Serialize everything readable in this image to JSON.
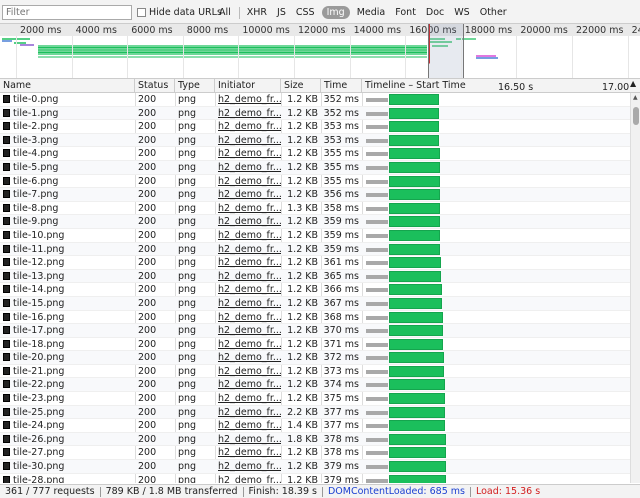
{
  "filterbar": {
    "filter_placeholder": "Filter",
    "hide_data_urls_label": "Hide data URLs",
    "types": [
      "All",
      "XHR",
      "JS",
      "CSS",
      "Img",
      "Media",
      "Font",
      "Doc",
      "WS",
      "Other"
    ],
    "active_type": "Img"
  },
  "overview": {
    "ticks": [
      "2000 ms",
      "4000 ms",
      "6000 ms",
      "8000 ms",
      "10000 ms",
      "12000 ms",
      "14000 ms",
      "16000 ms",
      "18000 ms",
      "20000 ms",
      "22000 ms",
      "240"
    ]
  },
  "columns": {
    "name": "Name",
    "status": "Status",
    "type": "Type",
    "initiator": "Initiator",
    "size": "Size",
    "time": "Time",
    "timeline": "Timeline – Start Time",
    "timeline_ticks": [
      "16.50 s",
      "17.00"
    ]
  },
  "rows": [
    {
      "name": "tile-0.png",
      "status": "200",
      "type": "png",
      "initiator": "h2_demo_fr...",
      "size": "1.2 KB",
      "time": "352 ms",
      "recv_pct": 78
    },
    {
      "name": "tile-1.png",
      "status": "200",
      "type": "png",
      "initiator": "h2_demo_fr...",
      "size": "1.2 KB",
      "time": "352 ms",
      "recv_pct": 78
    },
    {
      "name": "tile-2.png",
      "status": "200",
      "type": "png",
      "initiator": "h2_demo_fr...",
      "size": "1.2 KB",
      "time": "353 ms",
      "recv_pct": 78
    },
    {
      "name": "tile-3.png",
      "status": "200",
      "type": "png",
      "initiator": "h2_demo_fr...",
      "size": "1.2 KB",
      "time": "353 ms",
      "recv_pct": 78
    },
    {
      "name": "tile-4.png",
      "status": "200",
      "type": "png",
      "initiator": "h2_demo_fr...",
      "size": "1.2 KB",
      "time": "355 ms",
      "recv_pct": 79
    },
    {
      "name": "tile-5.png",
      "status": "200",
      "type": "png",
      "initiator": "h2_demo_fr...",
      "size": "1.2 KB",
      "time": "355 ms",
      "recv_pct": 79
    },
    {
      "name": "tile-6.png",
      "status": "200",
      "type": "png",
      "initiator": "h2_demo_fr...",
      "size": "1.2 KB",
      "time": "355 ms",
      "recv_pct": 79
    },
    {
      "name": "tile-7.png",
      "status": "200",
      "type": "png",
      "initiator": "h2_demo_fr...",
      "size": "1.2 KB",
      "time": "356 ms",
      "recv_pct": 79
    },
    {
      "name": "tile-8.png",
      "status": "200",
      "type": "png",
      "initiator": "h2_demo_fr...",
      "size": "1.3 KB",
      "time": "358 ms",
      "recv_pct": 80
    },
    {
      "name": "tile-9.png",
      "status": "200",
      "type": "png",
      "initiator": "h2_demo_fr...",
      "size": "1.2 KB",
      "time": "359 ms",
      "recv_pct": 80
    },
    {
      "name": "tile-10.png",
      "status": "200",
      "type": "png",
      "initiator": "h2_demo_fr...",
      "size": "1.2 KB",
      "time": "359 ms",
      "recv_pct": 80
    },
    {
      "name": "tile-11.png",
      "status": "200",
      "type": "png",
      "initiator": "h2_demo_fr...",
      "size": "1.2 KB",
      "time": "359 ms",
      "recv_pct": 80
    },
    {
      "name": "tile-12.png",
      "status": "200",
      "type": "png",
      "initiator": "h2_demo_fr...",
      "size": "1.2 KB",
      "time": "361 ms",
      "recv_pct": 81
    },
    {
      "name": "tile-13.png",
      "status": "200",
      "type": "png",
      "initiator": "h2_demo_fr...",
      "size": "1.2 KB",
      "time": "365 ms",
      "recv_pct": 82
    },
    {
      "name": "tile-14.png",
      "status": "200",
      "type": "png",
      "initiator": "h2_demo_fr...",
      "size": "1.2 KB",
      "time": "366 ms",
      "recv_pct": 83
    },
    {
      "name": "tile-15.png",
      "status": "200",
      "type": "png",
      "initiator": "h2_demo_fr...",
      "size": "1.2 KB",
      "time": "367 ms",
      "recv_pct": 83
    },
    {
      "name": "tile-16.png",
      "status": "200",
      "type": "png",
      "initiator": "h2_demo_fr...",
      "size": "1.2 KB",
      "time": "368 ms",
      "recv_pct": 84
    },
    {
      "name": "tile-17.png",
      "status": "200",
      "type": "png",
      "initiator": "h2_demo_fr...",
      "size": "1.2 KB",
      "time": "370 ms",
      "recv_pct": 85
    },
    {
      "name": "tile-18.png",
      "status": "200",
      "type": "png",
      "initiator": "h2_demo_fr...",
      "size": "1.2 KB",
      "time": "371 ms",
      "recv_pct": 85
    },
    {
      "name": "tile-20.png",
      "status": "200",
      "type": "png",
      "initiator": "h2_demo_fr...",
      "size": "1.2 KB",
      "time": "372 ms",
      "recv_pct": 86
    },
    {
      "name": "tile-21.png",
      "status": "200",
      "type": "png",
      "initiator": "h2_demo_fr...",
      "size": "1.2 KB",
      "time": "373 ms",
      "recv_pct": 86
    },
    {
      "name": "tile-22.png",
      "status": "200",
      "type": "png",
      "initiator": "h2_demo_fr...",
      "size": "1.2 KB",
      "time": "374 ms",
      "recv_pct": 87
    },
    {
      "name": "tile-23.png",
      "status": "200",
      "type": "png",
      "initiator": "h2_demo_fr...",
      "size": "1.2 KB",
      "time": "375 ms",
      "recv_pct": 87
    },
    {
      "name": "tile-25.png",
      "status": "200",
      "type": "png",
      "initiator": "h2_demo_fr...",
      "size": "2.2 KB",
      "time": "377 ms",
      "recv_pct": 88
    },
    {
      "name": "tile-24.png",
      "status": "200",
      "type": "png",
      "initiator": "h2_demo_fr...",
      "size": "1.4 KB",
      "time": "377 ms",
      "recv_pct": 88
    },
    {
      "name": "tile-26.png",
      "status": "200",
      "type": "png",
      "initiator": "h2_demo_fr...",
      "size": "1.8 KB",
      "time": "378 ms",
      "recv_pct": 89
    },
    {
      "name": "tile-27.png",
      "status": "200",
      "type": "png",
      "initiator": "h2_demo_fr...",
      "size": "1.2 KB",
      "time": "378 ms",
      "recv_pct": 89
    },
    {
      "name": "tile-30.png",
      "status": "200",
      "type": "png",
      "initiator": "h2_demo_fr...",
      "size": "1.2 KB",
      "time": "379 ms",
      "recv_pct": 89
    },
    {
      "name": "tile-28.png",
      "status": "200",
      "type": "png",
      "initiator": "h2_demo_fr...",
      "size": "1.2 KB",
      "time": "379 ms",
      "recv_pct": 89
    }
  ],
  "statusbar": {
    "requests": "361 / 777 requests",
    "transferred": "789 KB / 1.8 MB transferred",
    "finish": "Finish: 18.39 s",
    "dom_loaded": "DOMContentLoaded: 685 ms",
    "load": "Load: 15.36 s"
  },
  "colors": {
    "receiving": "#1bbf5c",
    "waiting": "#a9a9a9",
    "dom_loaded": "#1a3fd1",
    "load": "#d32020"
  }
}
